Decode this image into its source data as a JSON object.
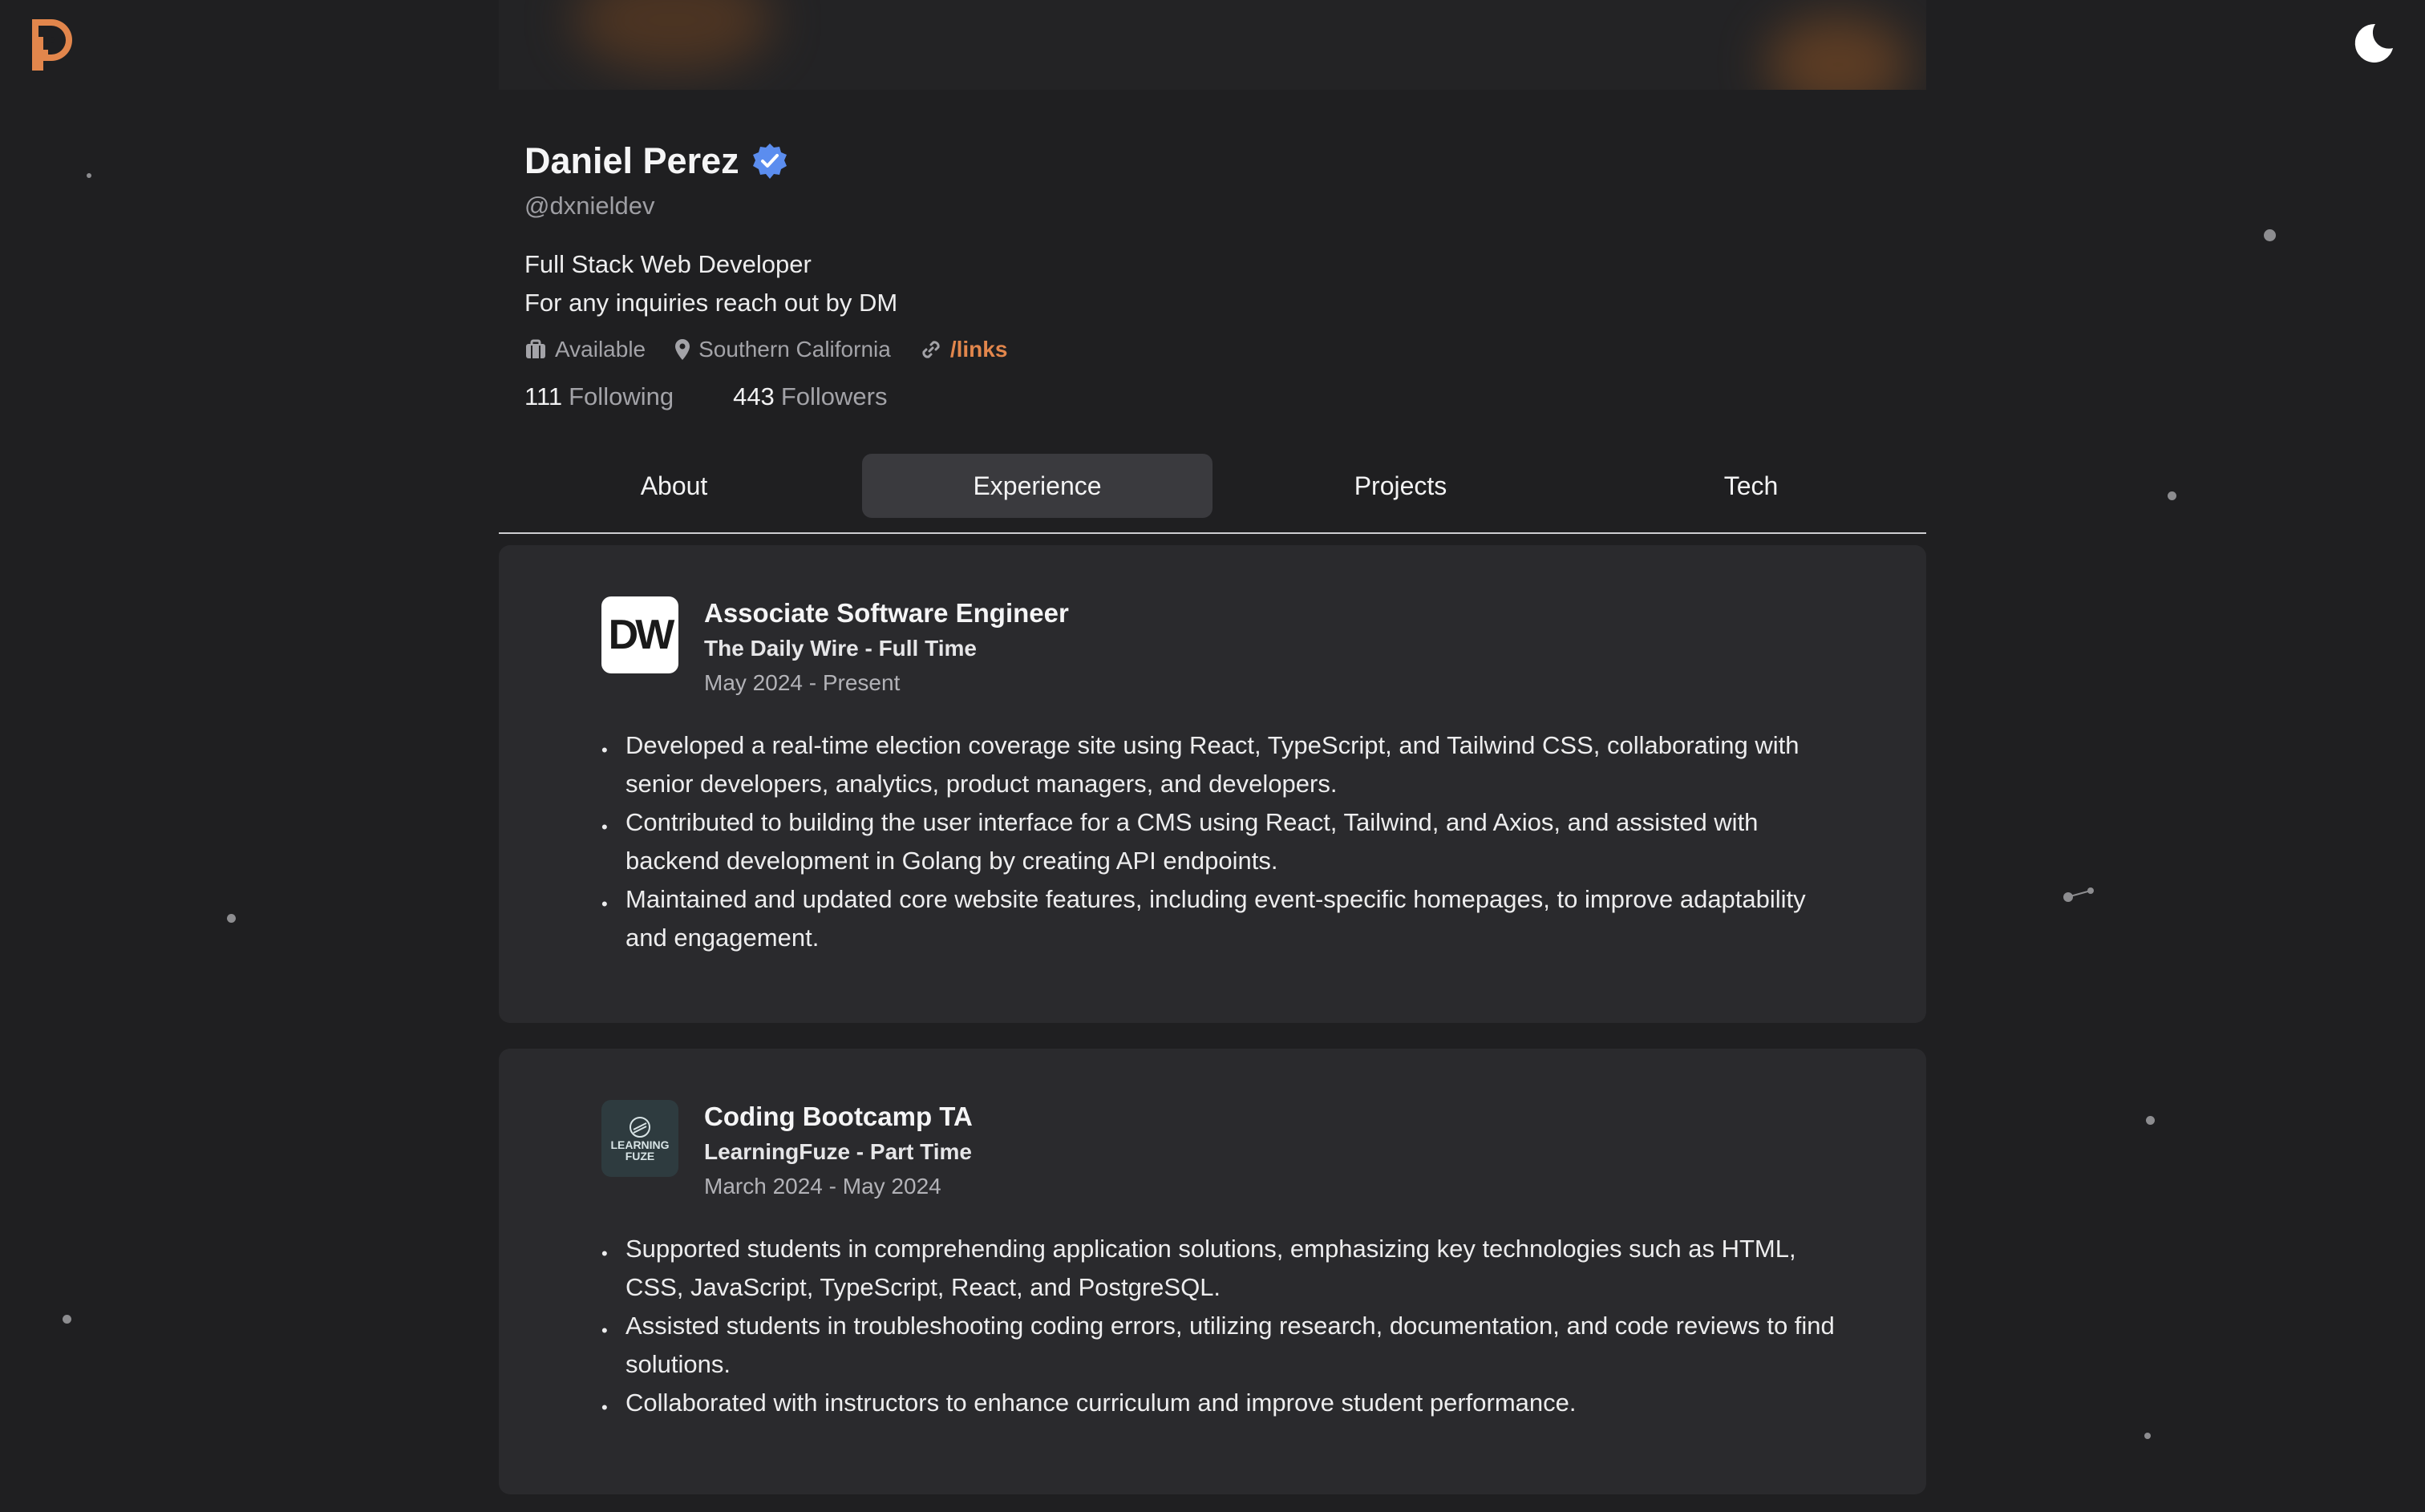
{
  "profile": {
    "name": "Daniel Perez",
    "handle": "@dxnieldev",
    "bio_line1": "Full Stack Web Developer",
    "bio_line2": "For any inquiries reach out by DM",
    "status": "Available",
    "location": "Southern California",
    "link": "/links",
    "following_count": "111",
    "following_label": "Following",
    "followers_count": "443",
    "followers_label": "Followers"
  },
  "tabs": [
    {
      "label": "About"
    },
    {
      "label": "Experience"
    },
    {
      "label": "Projects"
    },
    {
      "label": "Tech"
    }
  ],
  "experience": [
    {
      "logo_text": "DW",
      "title": "Associate Software Engineer",
      "company": "The Daily Wire - Full Time",
      "dates": "May 2024 - Present",
      "bullets": [
        "Developed a real-time election coverage site using React, TypeScript, and Tailwind CSS, collaborating with senior developers, analytics, product managers, and developers.",
        "Contributed to building the user interface for a CMS using React, Tailwind, and Axios, and assisted with backend development in Golang by creating API endpoints.",
        "Maintained and updated core website features, including event-specific homepages, to improve adaptability and engagement."
      ]
    },
    {
      "logo_text_1": "LEARNING",
      "logo_text_2": "FUZE",
      "title": "Coding Bootcamp TA",
      "company": "LearningFuze - Part Time",
      "dates": "March 2024 - May 2024",
      "bullets": [
        "Supported students in comprehending application solutions, emphasizing key technologies such as HTML, CSS, JavaScript, TypeScript, React, and PostgreSQL.",
        "Assisted students in troubleshooting coding errors, utilizing research, documentation, and code reviews to find solutions.",
        "Collaborated with instructors to enhance curriculum and improve student performance."
      ]
    }
  ],
  "icons": {
    "logo": "dp-logo-icon",
    "theme": "moon-icon",
    "verified": "verified-badge-icon",
    "status": "briefcase-icon",
    "location": "map-pin-icon",
    "link": "link-icon"
  },
  "colors": {
    "background": "#1f1f21",
    "card": "#2a2a2d",
    "accent": "#e2864c",
    "verified": "#5b8def"
  }
}
